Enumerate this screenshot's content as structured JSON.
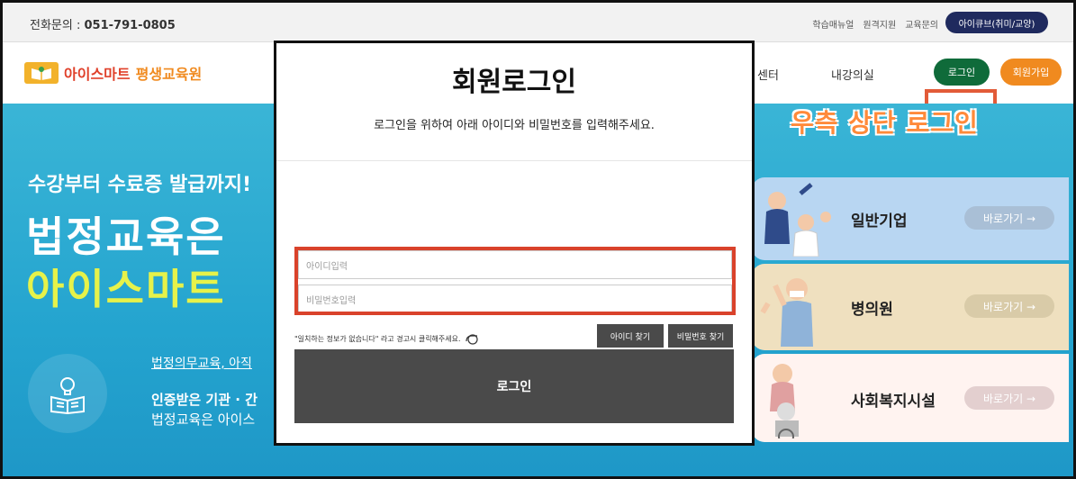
{
  "topbar": {
    "tel_label": "전화문의 : ",
    "tel_number": "051-791-0805",
    "links": [
      "학습매뉴얼",
      "원격지원",
      "교육문의"
    ],
    "icube": "아이큐브(취미/교양)"
  },
  "header": {
    "logo_part1": "아이스마트",
    "logo_part2": "평생교육원",
    "nav_partial": "센터",
    "nav_lecture": "내강의실",
    "login": "로그인",
    "join": "회원가입"
  },
  "hero": {
    "sub": "수강부터 수료증 발급까지!",
    "title1": "법정교육은",
    "title2": "아이스마트",
    "link": "법정의무교육, 아직",
    "bold_line": "인증받은 기관 · 간",
    "line": "법정교육은 아이스",
    "callout": "우측 상단 로그인"
  },
  "cards": [
    {
      "title": "일반기업",
      "btn": "바로가기 →"
    },
    {
      "title": "병의원",
      "btn": "바로가기 →"
    },
    {
      "title": "사회복지시설",
      "btn": "바로가기 →"
    }
  ],
  "modal": {
    "title": "회원로그인",
    "desc": "로그인을 위하여 아래 아이디와 비밀번호를 입력해주세요.",
    "id_placeholder": "아이디입력",
    "pw_placeholder": "비밀번호입력",
    "hint": "\"일치하는 정보가 없습니다\" 라고 경고시 클릭해주세요.",
    "find_id": "아이디 찾기",
    "find_pw": "비밀번호 찾기",
    "login": "로그인"
  },
  "colors": {
    "hero_bg": "#24a4cf",
    "accent_green": "#0f6b3a",
    "accent_orange": "#f08a1f",
    "highlight_red": "#d9422b"
  }
}
